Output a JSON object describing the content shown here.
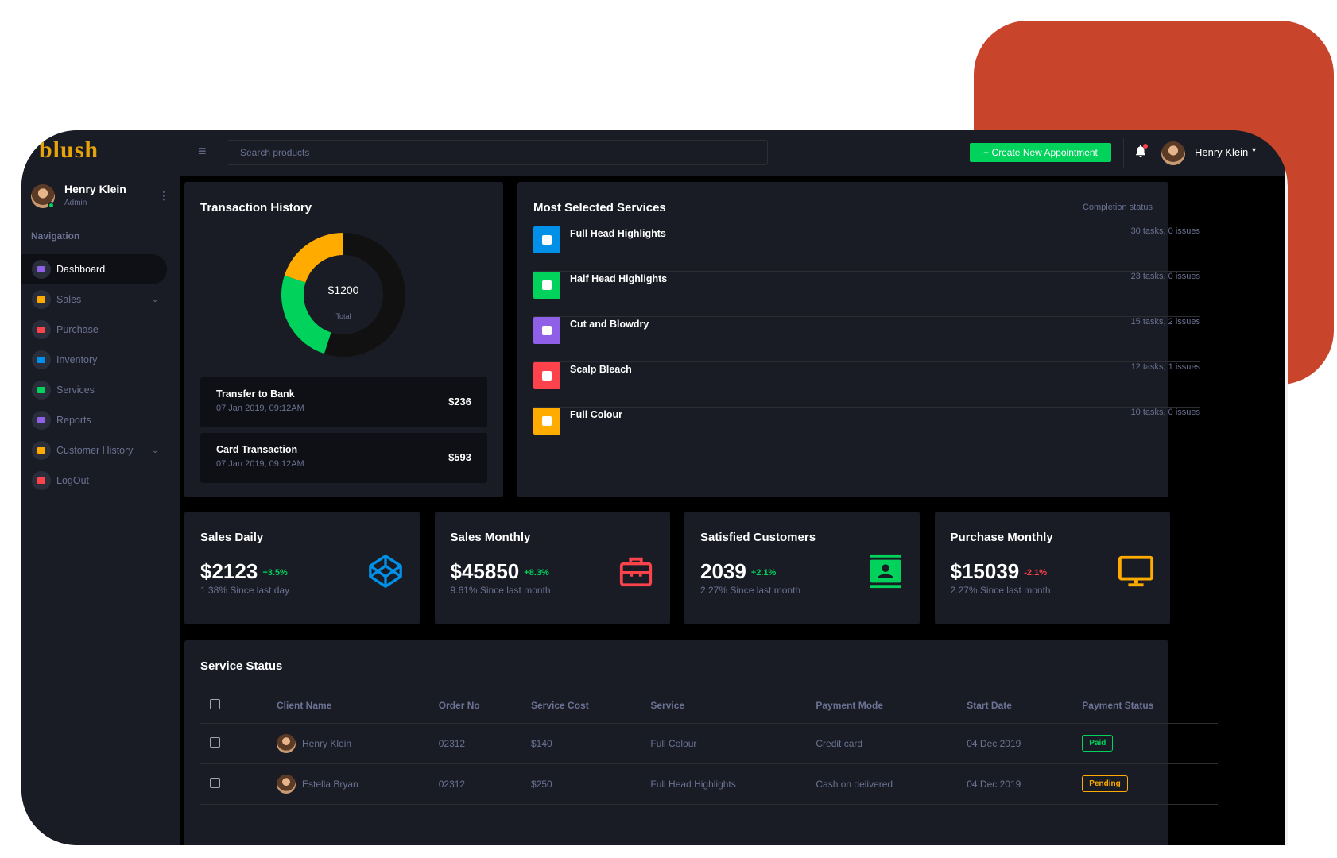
{
  "brand": {
    "logo": "blush"
  },
  "topbar": {
    "search_placeholder": "Search products",
    "create_button": "+ Create New Appointment",
    "user_name": "Henry Klein"
  },
  "sidebar": {
    "profile": {
      "name": "Henry Klein",
      "role": "Admin"
    },
    "heading": "Navigation",
    "items": [
      {
        "label": "Dashboard",
        "icon": "dashboard-icon",
        "color": "#8f5fe8",
        "active": true
      },
      {
        "label": "Sales",
        "icon": "laptop-icon",
        "color": "#ffab00",
        "chevron": true
      },
      {
        "label": "Purchase",
        "icon": "playlist-icon",
        "color": "#fc424a"
      },
      {
        "label": "Inventory",
        "icon": "table-icon",
        "color": "#0090e7"
      },
      {
        "label": "Services",
        "icon": "chart-bar-icon",
        "color": "#00d25b"
      },
      {
        "label": "Reports",
        "icon": "contacts-icon",
        "color": "#8f5fe8"
      },
      {
        "label": "Customer History",
        "icon": "security-icon",
        "color": "#ffab00",
        "chevron": true
      },
      {
        "label": "LogOut",
        "icon": "logout-icon",
        "color": "#fc424a"
      }
    ]
  },
  "transaction_history": {
    "title": "Transaction History",
    "total": "$1200",
    "total_label": "Total",
    "donut_segments": [
      {
        "value": 55,
        "color": "#111111"
      },
      {
        "value": 25,
        "color": "#00d25b"
      },
      {
        "value": 20,
        "color": "#ffab00"
      }
    ],
    "transactions": [
      {
        "name": "Transfer to Bank",
        "date": "07 Jan 2019, 09:12AM",
        "amount": "$236"
      },
      {
        "name": "Card Transaction",
        "date": "07 Jan 2019, 09:12AM",
        "amount": "$593"
      }
    ]
  },
  "services": {
    "title": "Most Selected Services",
    "status_label": "Completion status",
    "items": [
      {
        "name": "Full Head Highlights",
        "meta": "30 tasks, 0 issues",
        "color": "#0090e7",
        "icon": "file-icon"
      },
      {
        "name": "Half Head Highlights",
        "meta": "23 tasks, 0 issues",
        "color": "#00d25b",
        "icon": "cloud-upload-icon"
      },
      {
        "name": "Cut and Blowdry",
        "meta": "15 tasks, 2 issues",
        "color": "#8f5fe8",
        "icon": "clock-icon"
      },
      {
        "name": "Scalp Bleach",
        "meta": "12 tasks, 1 issues",
        "color": "#fc424a",
        "icon": "email-open-icon"
      },
      {
        "name": "Full Colour",
        "meta": "10 tasks, 0 issues",
        "color": "#ffab00",
        "icon": "chart-pie-icon"
      }
    ]
  },
  "stats": [
    {
      "title": "Sales Daily",
      "value": "$2123",
      "change": "+3.5%",
      "change_color": "#00d25b",
      "sub": "1.38% Since last day",
      "icon": "codepen-icon",
      "icon_color": "#0090e7"
    },
    {
      "title": "Sales Monthly",
      "value": "$45850",
      "change": "+8.3%",
      "change_color": "#00d25b",
      "sub": "9.61% Since last month",
      "icon": "briefcase-icon",
      "icon_color": "#fc424a"
    },
    {
      "title": "Satisfied Customers",
      "value": "2039",
      "change": "+2.1%",
      "change_color": "#00d25b",
      "sub": "2.27% Since last month",
      "icon": "contacts-icon",
      "icon_color": "#00d25b"
    },
    {
      "title": "Purchase Monthly",
      "value": "$15039",
      "change": "-2.1%",
      "change_color": "#fc424a",
      "sub": "2.27% Since last month",
      "icon": "monitor-icon",
      "icon_color": "#ffab00"
    }
  ],
  "service_status": {
    "title": "Service Status",
    "columns": [
      "Client Name",
      "Order No",
      "Service Cost",
      "Service",
      "Payment Mode",
      "Start Date",
      "Payment Status"
    ],
    "rows": [
      {
        "client": "Henry Klein",
        "order": "02312",
        "cost": "$140",
        "service": "Full Colour",
        "mode": "Credit card",
        "date": "04 Dec 2019",
        "status": "Paid",
        "status_color": "#00d25b"
      },
      {
        "client": "Estella Bryan",
        "order": "02312",
        "cost": "$250",
        "service": "Full Head Highlights",
        "mode": "Cash on delivered",
        "date": "04 Dec 2019",
        "status": "Pending",
        "status_color": "#ffab00"
      }
    ]
  }
}
